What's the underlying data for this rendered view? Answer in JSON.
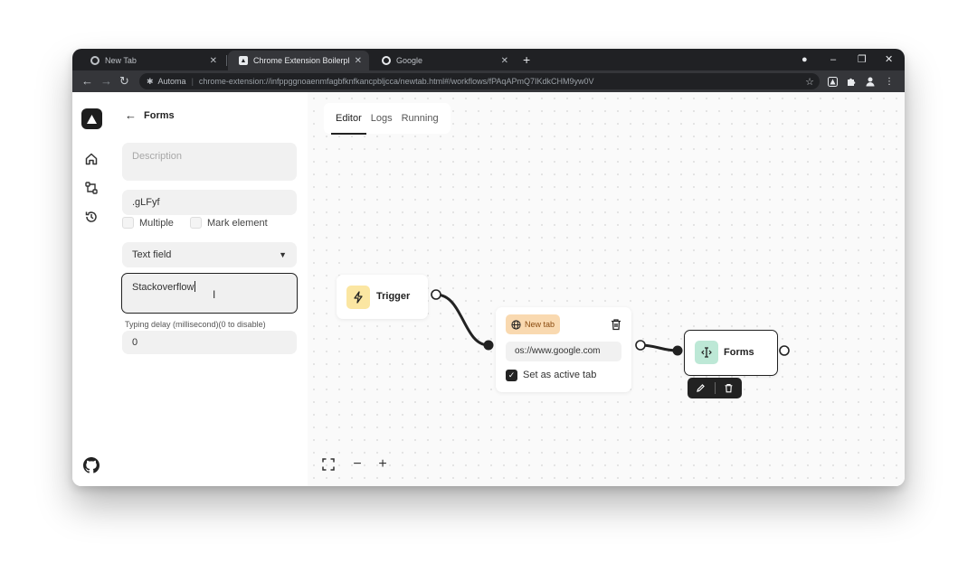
{
  "browser": {
    "tabs": [
      {
        "title": "New Tab",
        "active": false
      },
      {
        "title": "Chrome Extension Boilerplate (wi",
        "active": true
      },
      {
        "title": "Google",
        "active": false
      }
    ],
    "new_tab_glyph": "+",
    "window_controls": [
      "–",
      "❐",
      "✕"
    ],
    "address": {
      "site_label": "Automa",
      "url": "chrome-extension://infppggnoaenmfagbfknfkancpbljcca/newtab.html#/workflows/fPAqAPmQ7IKdkCHM9yw0V"
    }
  },
  "panel": {
    "title": "Forms",
    "description_placeholder": "Description",
    "selector_value": ".gLFyf",
    "multiple_label": "Multiple",
    "mark_element_label": "Mark element",
    "type_value": "Text field",
    "text_value": "Stackoverflow",
    "delay_label": "Typing delay (millisecond)(0 to disable)",
    "delay_value": "0"
  },
  "editor": {
    "tabs": [
      {
        "label": "Editor",
        "active": true
      },
      {
        "label": "Logs",
        "active": false
      },
      {
        "label": "Running",
        "active": false
      }
    ],
    "nodes": {
      "trigger": {
        "label": "Trigger"
      },
      "new_tab": {
        "badge": "New tab",
        "url": "os://www.google.com",
        "active_tab_label": "Set as active tab",
        "active_tab_checked": true
      },
      "forms": {
        "label": "Forms"
      }
    }
  },
  "colors": {
    "trigger_icon_bg": "#fbe6a2",
    "new_tab_badge_bg": "#f9d9b0",
    "forms_icon_bg": "#bde8d6",
    "chrome_dark": "#202124"
  }
}
